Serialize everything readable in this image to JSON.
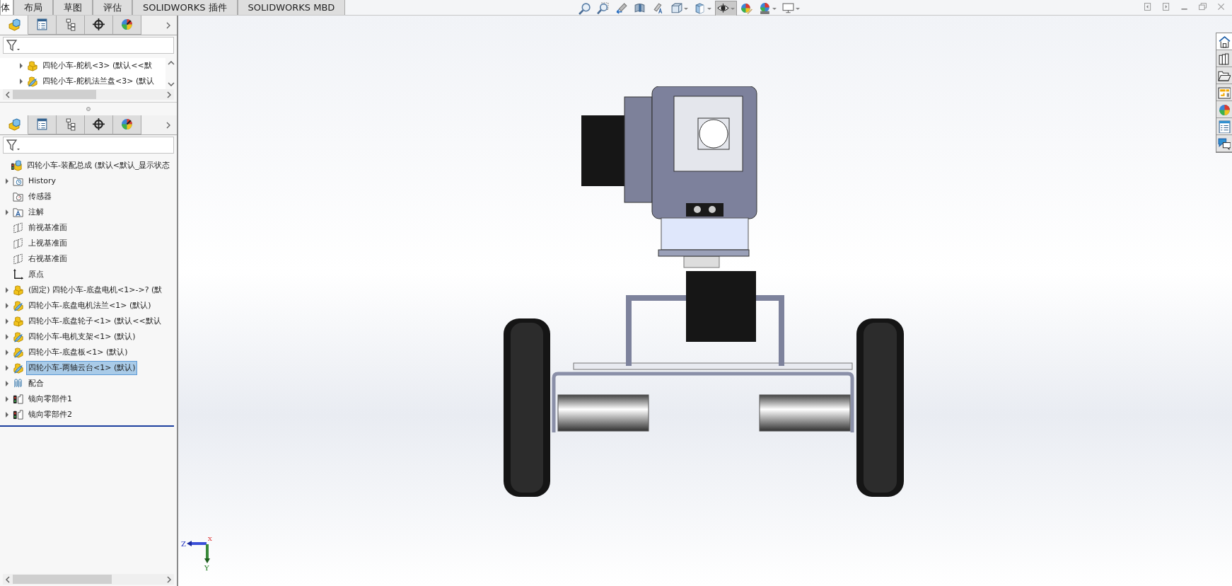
{
  "command_tabs": [
    {
      "label": "体",
      "selected": true
    },
    {
      "label": "布局",
      "selected": false
    },
    {
      "label": "草图",
      "selected": false
    },
    {
      "label": "评估",
      "selected": false
    },
    {
      "label": "SOLIDWORKS 插件",
      "selected": false
    },
    {
      "label": "SOLIDWORKS MBD",
      "selected": false
    }
  ],
  "heads_up_toolbar": [
    {
      "kind": "zoom-fit",
      "dropdown": false,
      "pressed": false
    },
    {
      "kind": "zoom-area",
      "dropdown": false,
      "pressed": false
    },
    {
      "kind": "previous-view",
      "dropdown": false,
      "pressed": false
    },
    {
      "kind": "section-view",
      "dropdown": false,
      "pressed": false
    },
    {
      "kind": "dynamic-annotation",
      "dropdown": false,
      "pressed": false
    },
    {
      "kind": "view-orientation",
      "dropdown": true,
      "pressed": false
    },
    {
      "kind": "display-style",
      "dropdown": true,
      "pressed": false
    },
    {
      "kind": "hide-show",
      "dropdown": true,
      "pressed": true
    },
    {
      "kind": "edit-appearance",
      "dropdown": false,
      "pressed": false
    },
    {
      "kind": "scene",
      "dropdown": true,
      "pressed": false
    },
    {
      "kind": "view-settings",
      "dropdown": true,
      "pressed": false
    }
  ],
  "window_controls": [
    {
      "kind": "tile-left"
    },
    {
      "kind": "tile-right"
    },
    {
      "kind": "minimize"
    },
    {
      "kind": "restore"
    },
    {
      "kind": "close"
    }
  ],
  "panes": [
    {
      "tabs": [
        {
          "kind": "feature-manager",
          "selected": true
        },
        {
          "kind": "property-manager",
          "selected": false
        },
        {
          "kind": "configuration-manager",
          "selected": false
        },
        {
          "kind": "dimxpert",
          "selected": false
        },
        {
          "kind": "display-manager",
          "selected": false
        }
      ],
      "tree": [
        {
          "kind": "part",
          "label": "四轮小车-舵机<3> (默认<<默",
          "expandable": true,
          "selected": false
        },
        {
          "kind": "part-edit",
          "label": "四轮小车-舵机法兰盘<3> (默认",
          "expandable": true,
          "selected": false
        }
      ]
    },
    {
      "tabs": [
        {
          "kind": "feature-manager",
          "selected": true
        },
        {
          "kind": "property-manager",
          "selected": false
        },
        {
          "kind": "configuration-manager",
          "selected": false
        },
        {
          "kind": "dimxpert",
          "selected": false
        },
        {
          "kind": "display-manager",
          "selected": false
        }
      ],
      "tree": [
        {
          "kind": "assembly",
          "label": "四轮小车-装配总成  (默认<默认_显示状态",
          "expandable": false,
          "selected": false,
          "children": [
            {
              "kind": "history",
              "label": "History",
              "expandable": true,
              "selected": false
            },
            {
              "kind": "sensor",
              "label": "传感器",
              "expandable": false,
              "selected": false
            },
            {
              "kind": "annotation",
              "label": "注解",
              "expandable": true,
              "selected": false
            },
            {
              "kind": "plane",
              "label": "前视基准面",
              "expandable": false,
              "selected": false
            },
            {
              "kind": "plane",
              "label": "上视基准面",
              "expandable": false,
              "selected": false
            },
            {
              "kind": "plane",
              "label": "右视基准面",
              "expandable": false,
              "selected": false
            },
            {
              "kind": "origin",
              "label": "原点",
              "expandable": false,
              "selected": false
            },
            {
              "kind": "part",
              "label": "(固定) 四轮小车-底盘电机<1>->? (默",
              "expandable": true,
              "selected": false
            },
            {
              "kind": "part-edit",
              "label": "四轮小车-底盘电机法兰<1> (默认)",
              "expandable": true,
              "selected": false
            },
            {
              "kind": "part",
              "label": "四轮小车-底盘轮子<1> (默认<<默认",
              "expandable": true,
              "selected": false
            },
            {
              "kind": "part-edit",
              "label": "四轮小车-电机支架<1> (默认)",
              "expandable": true,
              "selected": false
            },
            {
              "kind": "part-edit",
              "label": "四轮小车-底盘板<1> (默认)",
              "expandable": true,
              "selected": false
            },
            {
              "kind": "part-edit",
              "label": "四轮小车-两轴云台<1> (默认)",
              "expandable": true,
              "selected": true
            },
            {
              "kind": "mates",
              "label": "配合",
              "expandable": true,
              "selected": false
            },
            {
              "kind": "mirror",
              "label": "镜向零部件1",
              "expandable": true,
              "selected": false
            },
            {
              "kind": "mirror",
              "label": "镜向零部件2",
              "expandable": true,
              "selected": false
            }
          ]
        }
      ]
    }
  ],
  "task_pane": [
    {
      "kind": "home",
      "selected": true
    },
    {
      "kind": "library",
      "selected": false
    },
    {
      "kind": "file-explorer",
      "selected": false
    },
    {
      "kind": "view-palette",
      "selected": false
    },
    {
      "kind": "appearances",
      "selected": false
    },
    {
      "kind": "custom-properties",
      "selected": false
    },
    {
      "kind": "forum",
      "selected": false
    }
  ],
  "triad": {
    "labels": [
      "Z",
      "X",
      "Y"
    ]
  }
}
